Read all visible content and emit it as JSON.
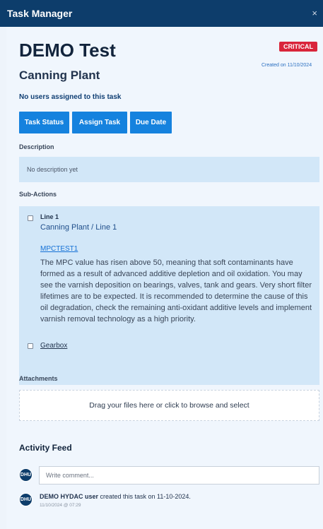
{
  "window": {
    "title": "Task Manager",
    "close_glyph": "×"
  },
  "task": {
    "title": "DEMO Test",
    "priority_badge": "CRITICAL",
    "priority_color": "#d9253a",
    "created": "Created on 11/10/2024",
    "location": "Canning Plant",
    "assignees_text": "No users assigned to this task"
  },
  "actions": {
    "task_status": "Task Status",
    "assign_task": "Assign Task",
    "due_date": "Due Date",
    "button_color": "#1582de"
  },
  "description": {
    "label": "Description",
    "text": "No description yet"
  },
  "subactions": {
    "label": "Sub-Actions",
    "items": [
      {
        "name": "Line 1",
        "path": "Canning Plant / Line 1",
        "link": "MPCTEST1",
        "text": "The MPC value has risen above 50, meaning that soft contaminants have formed as a result of advanced additive depletion and oil oxidation. You may see the varnish deposition on bearings, valves, tank and gears. Very short filter lifetimes are to be expected. It is recommended to determine the cause of this oil degradation, check the remaining anti-oxidant additive levels and implement varnish removal technology as a high priority.",
        "checked": false
      },
      {
        "name": "Gearbox",
        "checked": false
      }
    ]
  },
  "attachments": {
    "label": "Attachments",
    "dropzone_text": "Drag your files here or click to browse and select"
  },
  "activity": {
    "title": "Activity Feed",
    "avatar_initials": "DHU",
    "comment_placeholder": "Write comment...",
    "entries": [
      {
        "user": "DEMO HYDAC user",
        "action": " created this task on 11-10-2024.",
        "timestamp": "11/10/2024 @ 07:29"
      }
    ]
  },
  "colors": {
    "header": "#0d3d6b",
    "accent": "#1582de",
    "panel": "#f0f6fd",
    "box": "#d2e7f8"
  }
}
